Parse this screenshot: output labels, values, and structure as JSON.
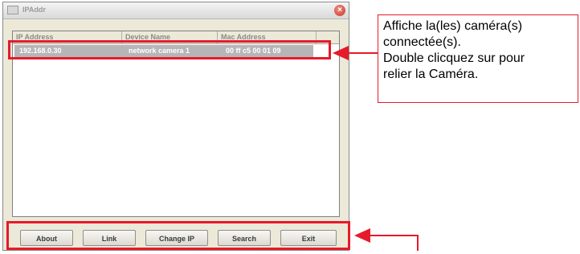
{
  "window": {
    "title": "IPAddr"
  },
  "listview": {
    "columns": [
      "IP Address",
      "Device Name",
      "Mac Address"
    ],
    "rows": [
      {
        "ip": "192.168.0.30",
        "name": "network camera 1",
        "mac": "00 ff c5 00 01 09"
      }
    ]
  },
  "buttons": {
    "about": "About",
    "link": "Link",
    "change_ip": "Change IP",
    "search": "Search",
    "exit": "Exit"
  },
  "callout": {
    "lines": [
      "Affiche la(les) caméra(s)",
      "connectée(s).",
      "Double clicquez sur pour",
      "relier la Caméra."
    ]
  },
  "colors": {
    "highlight": "#e51b2b",
    "selection": "#b6b6b6"
  }
}
